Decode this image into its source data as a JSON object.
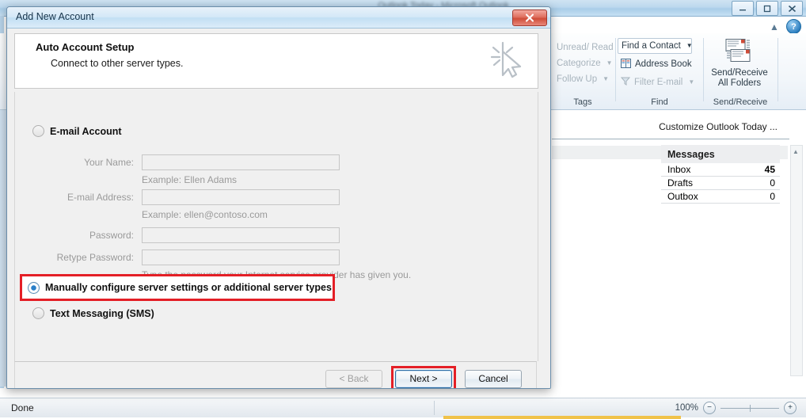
{
  "outlook": {
    "title": "Outlook Today - Microsoft Outlook",
    "window_controls": [
      {
        "name": "minimize",
        "glyph": "–"
      },
      {
        "name": "restore",
        "glyph": "□"
      },
      {
        "name": "close",
        "glyph": "✕"
      }
    ],
    "help_icon": "?",
    "collapse_ribbon_icon": "▲",
    "ribbon": {
      "groups": [
        {
          "name": "Tags",
          "label": "Tags",
          "items": [
            {
              "label": "Unread/ Read",
              "disabled": true,
              "dropdown": false
            },
            {
              "label": "Categorize",
              "disabled": true,
              "dropdown": true
            },
            {
              "label": "Follow Up",
              "disabled": true,
              "dropdown": true
            }
          ]
        },
        {
          "name": "Find",
          "label": "Find",
          "items": [
            {
              "label": "Find a Contact",
              "disabled": false,
              "dropdown": true,
              "boxed": true
            },
            {
              "label": "Address Book",
              "disabled": false,
              "dropdown": false,
              "icon": "address-book-icon"
            },
            {
              "label": "Filter E-mail",
              "disabled": true,
              "dropdown": true,
              "icon": "funnel-icon"
            }
          ]
        },
        {
          "name": "SendReceive",
          "label": "Send/Receive",
          "big_button": {
            "line1": "Send/Receive",
            "line2": "All Folders",
            "icon": "envelopes-icon"
          }
        }
      ]
    },
    "today": {
      "customize_link": "Customize Outlook Today ...",
      "messages_header": "Messages",
      "rows": [
        {
          "label": "Inbox",
          "value": "45",
          "bold": true
        },
        {
          "label": "Drafts",
          "value": "0",
          "bold": false
        },
        {
          "label": "Outbox",
          "value": "0",
          "bold": false
        }
      ]
    },
    "statusbar": {
      "status": "Done",
      "zoom_percent": "100%",
      "zoom_out": "−",
      "zoom_in": "+"
    }
  },
  "dialog": {
    "title": "Add New Account",
    "close_glyph": "✕",
    "header": {
      "heading": "Auto Account Setup",
      "subheading": "Connect to other server types.",
      "icon": "cursor-click-icon"
    },
    "options": {
      "email_account": {
        "label": "E-mail Account",
        "selected": false,
        "disabled": false
      },
      "text_messaging": {
        "label": "Text Messaging (SMS)",
        "selected": false,
        "disabled": false
      },
      "manual_config": {
        "label": "Manually configure server settings or additional server types",
        "selected": true,
        "disabled": false
      }
    },
    "form": {
      "fields": [
        {
          "label": "Your Name:",
          "value": "",
          "hint": "Example: Ellen Adams",
          "disabled": true
        },
        {
          "label": "E-mail Address:",
          "value": "",
          "hint": "Example: ellen@contoso.com",
          "disabled": true
        },
        {
          "label": "Password:",
          "value": "",
          "hint": "",
          "disabled": true
        },
        {
          "label": "Retype Password:",
          "value": "",
          "hint": "Type the password your Internet service provider has given you.",
          "disabled": true
        }
      ]
    },
    "buttons": {
      "back": {
        "label": "< Back",
        "disabled": true
      },
      "next": {
        "label": "Next >",
        "disabled": false,
        "highlighted": true
      },
      "cancel": {
        "label": "Cancel",
        "disabled": false
      }
    }
  },
  "colors": {
    "highlight_red": "#e41f26",
    "dialog_bg": "#f0f0f0",
    "accent_blue": "#2a7fc9"
  }
}
